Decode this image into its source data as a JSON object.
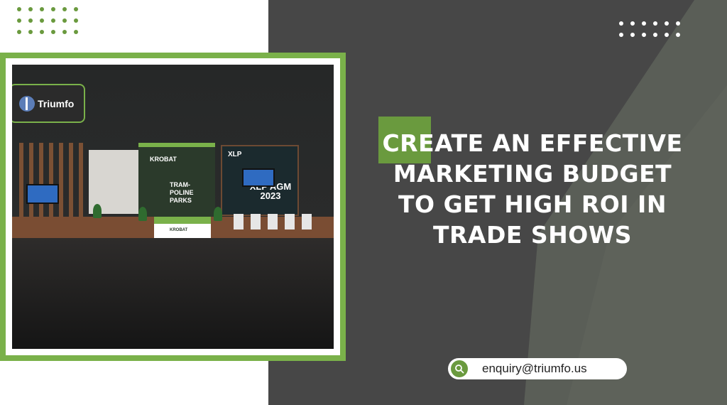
{
  "brand": {
    "logo_text": "Triumfo",
    "accent_color": "#6a9a3e",
    "frame_color": "#7ab14a",
    "panel_color": "#474747"
  },
  "booth": {
    "main_wall_brand": "KROBAT",
    "main_wall_text": "TRAM- POLINE PARKS",
    "counter_brand": "KROBAT",
    "screen_tag": "XLP",
    "screen_title": "XLP AGM 2023"
  },
  "headline": {
    "line1": "CREATE AN EFFECTIVE",
    "line2": "MARKETING BUDGET",
    "line3": "TO GET HIGH ROI IN",
    "line4": "TRADE SHOWS"
  },
  "contact": {
    "email": "enquiry@triumfo.us",
    "icon": "search-icon"
  }
}
